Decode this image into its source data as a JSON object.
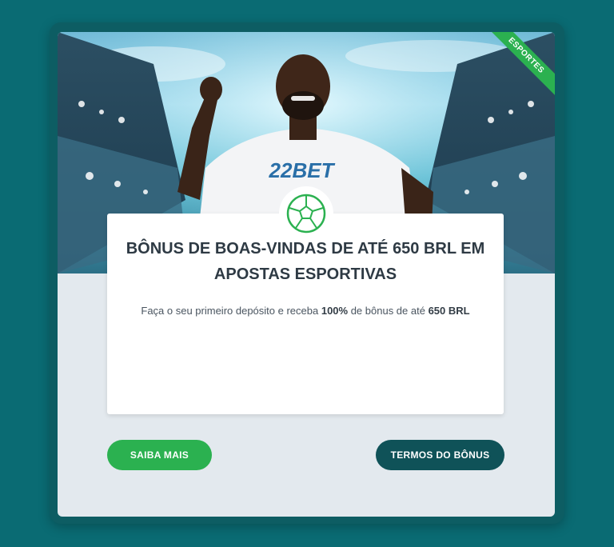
{
  "promo": {
    "ribbon_label": "ESPORTES",
    "shirt_logo": "22BET",
    "title": "BÔNUS DE BOAS-VINDAS DE ATÉ 650 BRL EM APOSTAS ESPORTIVAS",
    "description_parts": {
      "before": "Faça o seu primeiro depósito e receba ",
      "percent": "100%",
      "middle": " de bônus de até ",
      "amount": "650 BRL"
    },
    "icon": "soccer-ball-icon"
  },
  "buttons": {
    "more_label": "SAIBA MAIS",
    "terms_label": "TERMOS DO BÔNUS"
  },
  "colors": {
    "page_bg": "#0a6b73",
    "accent_green": "#2bb150",
    "dark_teal": "#0f5258"
  }
}
